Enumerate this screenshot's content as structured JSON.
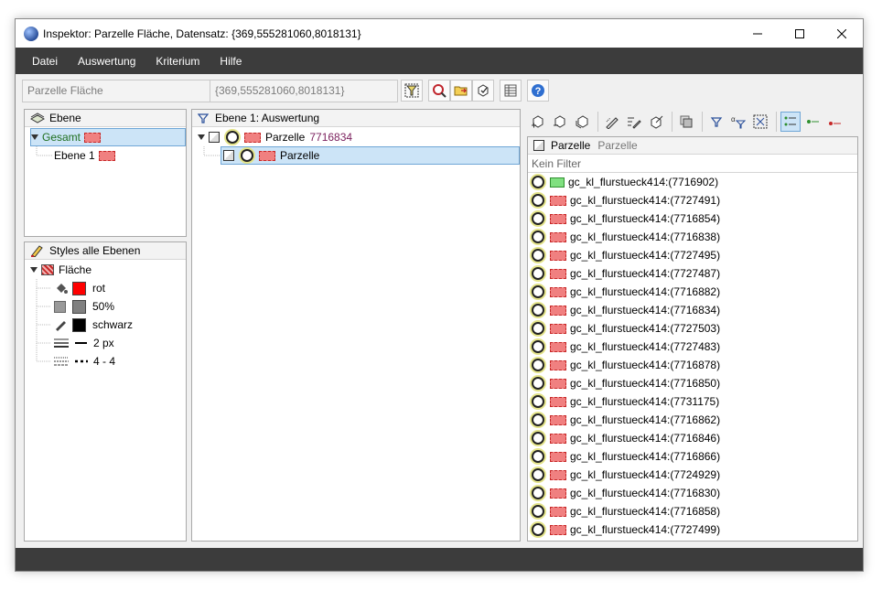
{
  "window": {
    "title": "Inspektor: Parzelle Fläche, Datensatz: {369,555281060,8018131}",
    "controls": [
      "minimize",
      "maximize",
      "close"
    ]
  },
  "menu": [
    "Datei",
    "Auswertung",
    "Kriterium",
    "Hilfe"
  ],
  "toolbar": {
    "layer_field": "Parzelle Fläche",
    "record_field": "{369,555281060,8018131}"
  },
  "layers_panel": {
    "title": "Ebene",
    "items": [
      {
        "label": "Gesamt",
        "selected": true
      },
      {
        "label": "Ebene 1",
        "selected": false
      }
    ]
  },
  "styles_panel": {
    "title": "Styles alle Ebenen",
    "root": "Fläche",
    "items": [
      {
        "icon": "fill-icon",
        "swatch": "#ff0000",
        "label": "rot"
      },
      {
        "icon": "opacity-icon",
        "swatch": "#808080",
        "label": "50%"
      },
      {
        "icon": "pen-icon",
        "swatch": "#000000",
        "label": "schwarz"
      },
      {
        "icon": "line-width-icon",
        "label": "2 px"
      },
      {
        "icon": "dash-pattern-icon",
        "label": "4 - 4"
      }
    ]
  },
  "evaluation_panel": {
    "title": "Ebene 1: Auswertung",
    "root": {
      "label": "Parzelle",
      "count": "7716834"
    },
    "child": {
      "label": "Parzelle",
      "selected": true
    }
  },
  "records_panel": {
    "header_label": "Parzelle",
    "header_sub": "Parzelle",
    "filter": "Kein Filter",
    "records": [
      {
        "label": "gc_kl_flurstueck414:(7716902)",
        "color": "green"
      },
      {
        "label": "gc_kl_flurstueck414:(7727491)",
        "color": "red"
      },
      {
        "label": "gc_kl_flurstueck414:(7716854)",
        "color": "red"
      },
      {
        "label": "gc_kl_flurstueck414:(7716838)",
        "color": "red"
      },
      {
        "label": "gc_kl_flurstueck414:(7727495)",
        "color": "red"
      },
      {
        "label": "gc_kl_flurstueck414:(7727487)",
        "color": "red"
      },
      {
        "label": "gc_kl_flurstueck414:(7716882)",
        "color": "red"
      },
      {
        "label": "gc_kl_flurstueck414:(7716834)",
        "color": "red"
      },
      {
        "label": "gc_kl_flurstueck414:(7727503)",
        "color": "red"
      },
      {
        "label": "gc_kl_flurstueck414:(7727483)",
        "color": "red"
      },
      {
        "label": "gc_kl_flurstueck414:(7716878)",
        "color": "red"
      },
      {
        "label": "gc_kl_flurstueck414:(7716850)",
        "color": "red"
      },
      {
        "label": "gc_kl_flurstueck414:(7731175)",
        "color": "red"
      },
      {
        "label": "gc_kl_flurstueck414:(7716862)",
        "color": "red"
      },
      {
        "label": "gc_kl_flurstueck414:(7716846)",
        "color": "red"
      },
      {
        "label": "gc_kl_flurstueck414:(7716866)",
        "color": "red"
      },
      {
        "label": "gc_kl_flurstueck414:(7724929)",
        "color": "red"
      },
      {
        "label": "gc_kl_flurstueck414:(7716830)",
        "color": "red"
      },
      {
        "label": "gc_kl_flurstueck414:(7716858)",
        "color": "red"
      },
      {
        "label": "gc_kl_flurstueck414:(7727499)",
        "color": "red"
      }
    ]
  },
  "colors": {
    "menubar": "#3c3c3c",
    "selection": "#cce4f7",
    "count_text": "#7a1f5c"
  }
}
